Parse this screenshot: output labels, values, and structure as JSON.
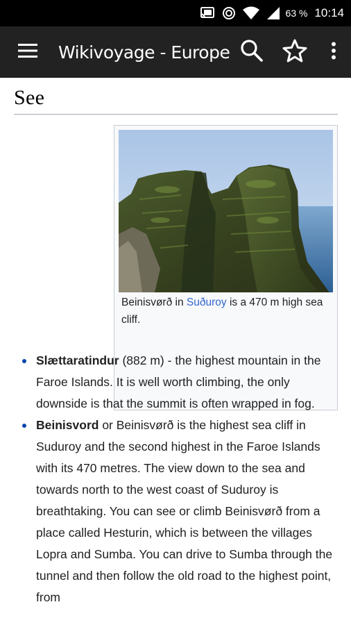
{
  "status_bar": {
    "battery": "63 %",
    "time": "10:14",
    "icons": [
      "cast-icon",
      "sync-icon",
      "wifi-icon",
      "signal-icon"
    ]
  },
  "app_bar": {
    "title": "Wikivoyage - Europe",
    "icons": [
      "menu-icon",
      "search-icon",
      "star-icon",
      "more-vert-icon"
    ]
  },
  "article": {
    "section_heading": "See",
    "figure": {
      "image_alt": "Beinisvørð sea cliff",
      "caption_before": "Beinisvørð in ",
      "caption_link": "Suðuroy",
      "caption_after": " is a 470 m high sea cliff."
    },
    "items": [
      {
        "title": "Slættaratindur",
        "text": " (882 m) - the highest mountain in the Faroe Islands. It is well worth climbing, the only downside is that the summit is often wrapped in fog."
      },
      {
        "title": "Beinisvord",
        "text": " or Beinisvørð is the highest sea cliff in Suduroy and the second highest in the Faroe Islands with its 470 metres. The view down to the sea and towards north to the west coast of Suduroy is breathtaking. You can see or climb Beinisvørð from a place called Hesturin, which is between the villages Lopra and Sumba. You can drive to Sumba through the tunnel and then follow the old road to the highest point, from"
      }
    ]
  }
}
